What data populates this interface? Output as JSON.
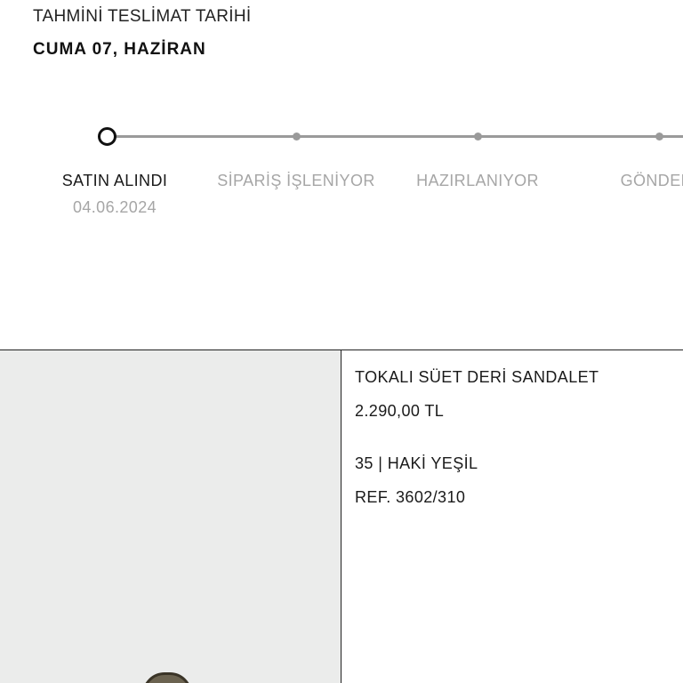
{
  "delivery": {
    "label": "TAHMİNİ TESLİMAT TARİHİ",
    "date": "CUMA 07, HAZİRAN"
  },
  "tracker": {
    "steps": [
      {
        "label": "SATIN ALINDI",
        "date": "04.06.2024",
        "state": "current"
      },
      {
        "label": "SİPARİŞ İŞLENİYOR",
        "state": "pending"
      },
      {
        "label": "HAZIRLANIYOR",
        "state": "pending"
      },
      {
        "label": "GÖNDERİ",
        "state": "pending"
      }
    ],
    "colors": {
      "line": "#9a9a9a",
      "active_text": "#1a1a1a",
      "inactive_text": "#a6a6a6"
    }
  },
  "product": {
    "name": "TOKALI SÜET DERİ SANDALET",
    "price": "2.290,00 TL",
    "variant": "35 | HAKİ YEŞİL",
    "reference": "REF. 3602/310",
    "image_background": "#ebeceb"
  }
}
